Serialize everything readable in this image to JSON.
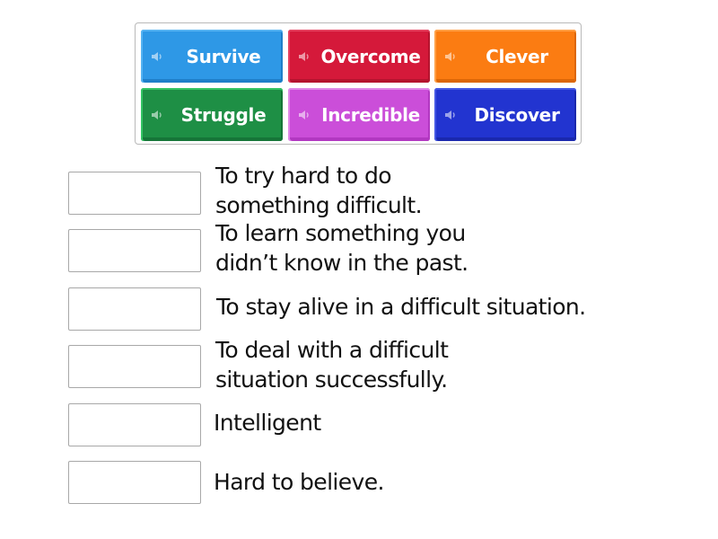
{
  "tiles": [
    {
      "label": "Survive",
      "icon": "speaker-icon",
      "color": "#2e98e6",
      "top": "#56b3f2",
      "shade": "#1f7fc9"
    },
    {
      "label": "Overcome",
      "icon": "speaker-icon",
      "color": "#d5193a",
      "top": "#e5415f",
      "shade": "#b5142f"
    },
    {
      "label": "Clever",
      "icon": "speaker-icon",
      "color": "#fb7c12",
      "top": "#ffa047",
      "shade": "#dc6708"
    },
    {
      "label": "Struggle",
      "icon": "speaker-icon",
      "color": "#1e8f45",
      "top": "#34c565",
      "shade": "#167538"
    },
    {
      "label": "Incredible",
      "icon": "speaker-icon",
      "color": "#cb4ed9",
      "top": "#e08ae8",
      "shade": "#b238c1"
    },
    {
      "label": "Discover",
      "icon": "speaker-icon",
      "color": "#2234d0",
      "top": "#4457e4",
      "shade": "#1a28ad"
    }
  ],
  "definitions": [
    {
      "lines": [
        "To try hard to do",
        "something difficult."
      ],
      "answer": ""
    },
    {
      "lines": [
        "To learn something you",
        "didn’t know in the past."
      ],
      "answer": ""
    },
    {
      "lines": [
        "To stay alive in a difficult situation."
      ],
      "answer": ""
    },
    {
      "lines": [
        "To deal with a difficult",
        "situation successfully."
      ],
      "answer": ""
    },
    {
      "lines": [
        "Intelligent"
      ],
      "answer": ""
    },
    {
      "lines": [
        "Hard to believe."
      ],
      "answer": ""
    }
  ]
}
